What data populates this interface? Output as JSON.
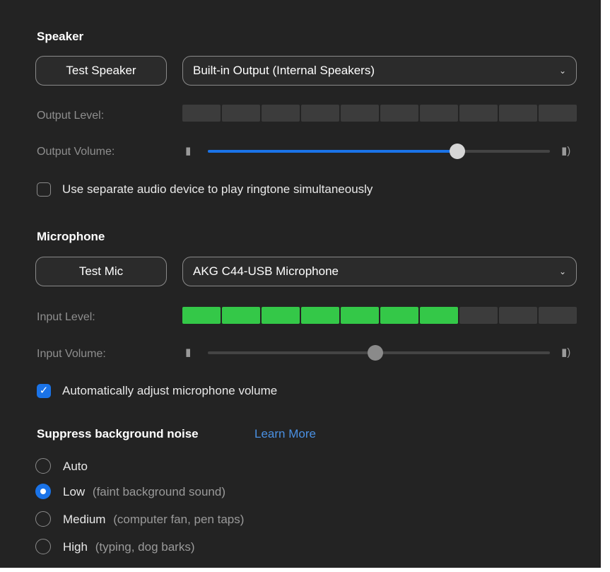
{
  "speaker": {
    "title": "Speaker",
    "test_button": "Test Speaker",
    "device": "Built-in Output (Internal Speakers)",
    "output_level_label": "Output Level:",
    "output_level_segments": 10,
    "output_level_active": 0,
    "output_volume_label": "Output Volume:",
    "output_volume_fraction": 0.73,
    "ringtone_checkbox_label": "Use separate audio device to play ringtone simultaneously",
    "ringtone_checked": false
  },
  "microphone": {
    "title": "Microphone",
    "test_button": "Test Mic",
    "device": "AKG C44-USB Microphone",
    "input_level_label": "Input Level:",
    "input_level_segments": 10,
    "input_level_active": 7,
    "input_volume_label": "Input Volume:",
    "input_volume_fraction": 0.49,
    "auto_adjust_label": "Automatically adjust microphone volume",
    "auto_adjust_checked": true
  },
  "noise": {
    "title": "Suppress background noise",
    "learn_more": "Learn More",
    "options": [
      {
        "label": "Auto",
        "hint": "",
        "selected": false
      },
      {
        "label": "Low",
        "hint": "(faint background sound)",
        "selected": true
      },
      {
        "label": "Medium",
        "hint": "(computer fan, pen taps)",
        "selected": false
      },
      {
        "label": "High",
        "hint": "(typing, dog barks)",
        "selected": false
      }
    ]
  },
  "colors": {
    "accent": "#1a73e8",
    "meter_active": "#34c848",
    "panel_bg": "#232323"
  },
  "icons": {
    "chevron": "chevron-down-icon",
    "volume_low": "speaker-low-icon",
    "volume_high": "speaker-high-icon",
    "check": "checkmark-icon"
  }
}
